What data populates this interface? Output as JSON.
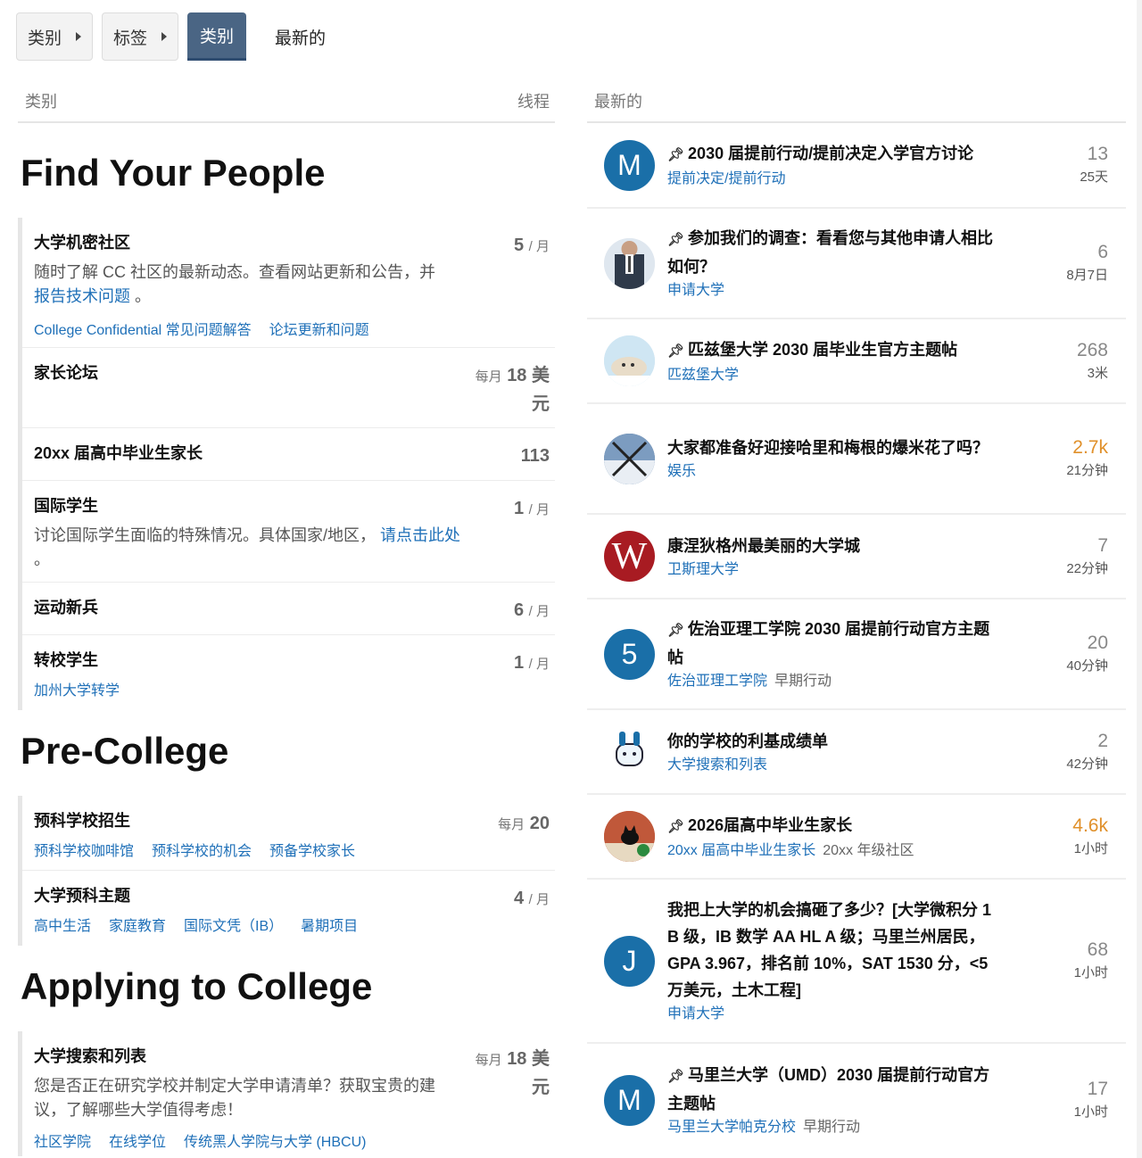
{
  "nav": {
    "dropdowns": [
      {
        "label": "类别"
      },
      {
        "label": "标签"
      }
    ],
    "tabs": [
      {
        "label": "类别",
        "active": true
      },
      {
        "label": "最新的",
        "active": false
      }
    ]
  },
  "categories_panel": {
    "header_left": "类别",
    "header_right": "线程",
    "sections": [
      {
        "title": "Find Your People",
        "categories": [
          {
            "name": "大学机密社区",
            "desc": "随时了解 CC 社区的最新动态。查看网站更新和公告，并",
            "desc_link": "报告技术问题",
            "desc_tail": "。",
            "subs": [
              "College Confidential 常见问题解答",
              "论坛更新和问题"
            ],
            "stat_num": "5",
            "stat_unit": "/ 月",
            "stat_prefix": ""
          },
          {
            "name": "家长论坛",
            "stat_prefix": "每月",
            "stat_num": "18 美元",
            "stat_unit": ""
          },
          {
            "name": "20xx 届高中毕业生家长",
            "stat_prefix": "",
            "stat_num": "113",
            "stat_unit": ""
          },
          {
            "name": "国际学生",
            "desc": "讨论国际学生面临的特殊情况。具体国家/地区，",
            "desc_link": "请点击此处",
            "desc_tail": "。",
            "stat_num": "1",
            "stat_unit": "/ 月",
            "stat_prefix": ""
          },
          {
            "name": "运动新兵",
            "stat_num": "6",
            "stat_unit": "/ 月",
            "stat_prefix": ""
          },
          {
            "name": "转校学生",
            "subs": [
              "加州大学转学"
            ],
            "stat_num": "1",
            "stat_unit": "/ 月",
            "stat_prefix": ""
          }
        ]
      },
      {
        "title": "Pre-College",
        "categories": [
          {
            "name": "预科学校招生",
            "subs": [
              "预科学校咖啡馆",
              "预科学校的机会",
              "预备学校家长"
            ],
            "stat_prefix": "每月",
            "stat_num": "20",
            "stat_unit": ""
          },
          {
            "name": "大学预科主题",
            "subs": [
              "高中生活",
              "家庭教育",
              "国际文凭（IB）",
              "暑期项目"
            ],
            "stat_num": "4",
            "stat_unit": "/ 月",
            "stat_prefix": ""
          }
        ]
      },
      {
        "title": "Applying to College",
        "categories": [
          {
            "name": "大学搜索和列表",
            "desc": "您是否正在研究学校并制定大学申请清单？获取宝贵的建议，了解哪些大学值得考虑！",
            "subs": [
              "社区学院",
              "在线学位",
              "传统黑人学院与大学 (HBCU)"
            ],
            "stat_prefix": "每月",
            "stat_num": "18 美元",
            "stat_unit": ""
          }
        ]
      }
    ]
  },
  "latest_panel": {
    "header": "最新的",
    "topics": [
      {
        "avatar_letter": "M",
        "avatar_color": "#1a6fa8",
        "pinned": true,
        "title": "2030 届提前行动/提前决定入学官方讨论",
        "category": "提前决定/提前行动",
        "tag": "",
        "count": "13",
        "age": "25天",
        "hot": false
      },
      {
        "avatar_letter": "",
        "avatar_color": "#334a63",
        "avatar_icon": "suit-avatar-icon",
        "pinned": true,
        "title": "参加我们的调查：看看您与其他申请人相比如何？",
        "category": "申请大学",
        "tag": "",
        "count": "6",
        "age": "8月7日",
        "hot": false
      },
      {
        "avatar_letter": "",
        "avatar_color": "#cfe6f3",
        "avatar_icon": "seal-avatar-icon",
        "pinned": true,
        "title": "匹兹堡大学 2030 届毕业生官方主题帖",
        "category": "匹兹堡大学",
        "tag": "",
        "count": "268",
        "age": "3米",
        "hot": false
      },
      {
        "avatar_letter": "",
        "avatar_color": "#4a6f9a",
        "avatar_icon": "sky-avatar-icon",
        "pinned": false,
        "title": "大家都准备好迎接哈里和梅根的爆米花了吗？",
        "category": "娱乐",
        "tag": "",
        "count": "2.7k",
        "age": "21分钟",
        "hot": true
      },
      {
        "avatar_letter": "W",
        "avatar_color": "#a81b22",
        "pinned": false,
        "title": "康涅狄格州最美丽的大学城",
        "category": "卫斯理大学",
        "tag": "",
        "count": "7",
        "age": "22分钟",
        "hot": false
      },
      {
        "avatar_letter": "5",
        "avatar_color": "#1a6fa8",
        "pinned": true,
        "title": "佐治亚理工学院 2030 届提前行动官方主题帖",
        "category": "佐治亚理工学院",
        "tag": "早期行动",
        "count": "20",
        "age": "40分钟",
        "hot": false
      },
      {
        "avatar_letter": "",
        "avatar_color": "#ffffff",
        "avatar_icon": "robot-avatar-icon",
        "pinned": false,
        "title": "你的学校的利基成绩单",
        "category": "大学搜索和列表",
        "tag": "",
        "count": "2",
        "age": "42分钟",
        "hot": false
      },
      {
        "avatar_letter": "",
        "avatar_color": "#c0583a",
        "avatar_icon": "cat-avatar-icon",
        "pinned": true,
        "title": "2026届高中毕业生家长",
        "category": "20xx 届高中毕业生家长",
        "tag": "20xx 年级社区",
        "count": "4.6k",
        "age": "1小时",
        "hot": true
      },
      {
        "avatar_letter": "J",
        "avatar_color": "#1a6fa8",
        "pinned": false,
        "title": "我把上大学的机会搞砸了多少？[大学微积分 1 B 级，IB 数学 AA HL A 级；马里兰州居民，GPA 3.967，排名前 10%，SAT 1530 分，<5 万美元，土木工程]",
        "category": "申请大学",
        "tag": "",
        "count": "68",
        "age": "1小时",
        "hot": false
      },
      {
        "avatar_letter": "M",
        "avatar_color": "#1a6fa8",
        "pinned": true,
        "title": "马里兰大学（UMD）2030 届提前行动官方主题帖",
        "category": "马里兰大学帕克分校",
        "tag": "早期行动",
        "count": "17",
        "age": "1小时",
        "hot": false
      }
    ]
  }
}
